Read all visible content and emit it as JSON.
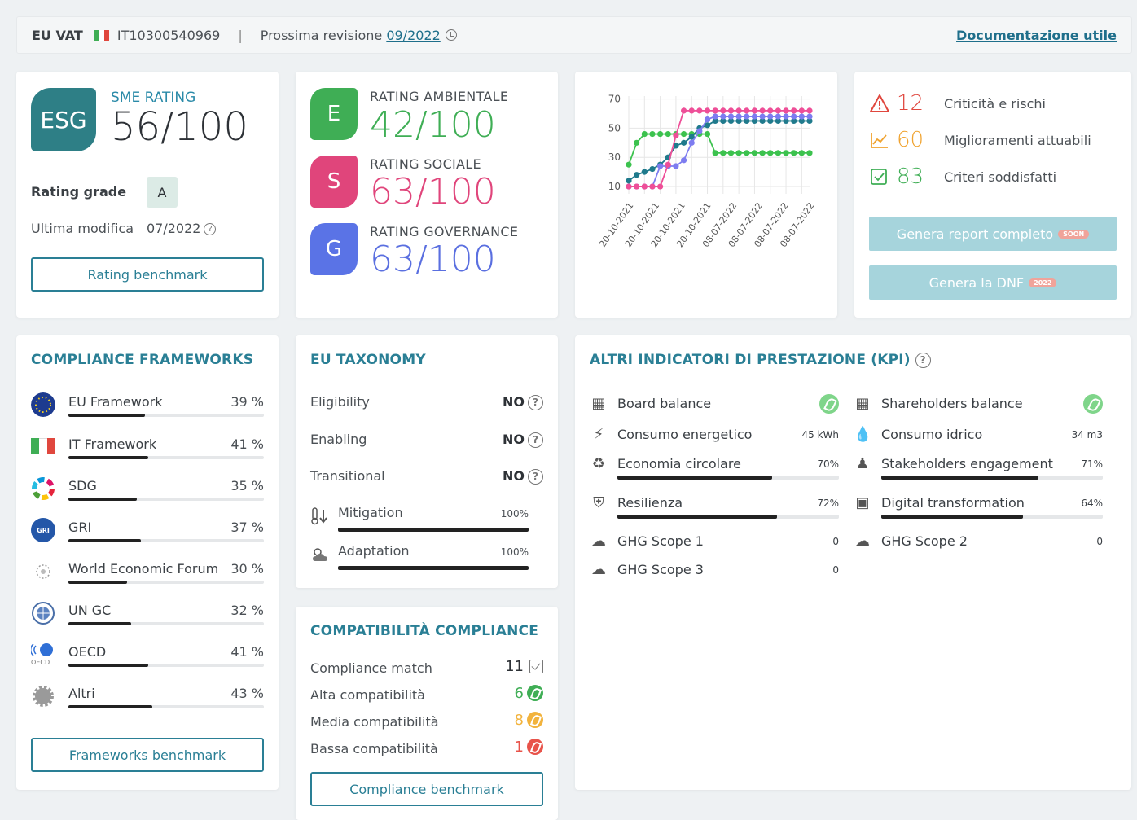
{
  "topbar": {
    "vat_label": "EU VAT",
    "vat_number": "IT10300540969",
    "separator": "|",
    "review_label": "Prossima revisione",
    "review_date": "09/2022",
    "doc_link": "Documentazione utile"
  },
  "sme": {
    "badge": "ESG",
    "label": "SME RATING",
    "value": "56/100",
    "grade_label": "Rating grade",
    "grade": "A",
    "modified_label": "Ultima modifica",
    "modified_value": "07/2022",
    "benchmark_button": "Rating benchmark"
  },
  "ratings": [
    {
      "badge": "E",
      "label": "RATING AMBIENTALE",
      "value": "42/100",
      "color": "#3fae55",
      "badge_color": "#3fae55"
    },
    {
      "badge": "S",
      "label": "RATING SOCIALE",
      "value": "63/100",
      "color": "#e0457b",
      "badge_color": "#e0457b"
    },
    {
      "badge": "G",
      "label": "RATING GOVERNANCE",
      "value": "63/100",
      "color": "#5a6fe0",
      "badge_color": "#5a73e6"
    }
  ],
  "chart_data": {
    "type": "line",
    "categories": [
      "20-10-2021",
      "20-10-2021",
      "20-10-2021",
      "20-10-2021",
      "08-07-2022",
      "08-07-2022",
      "08-07-2022",
      "08-07-2022"
    ],
    "xlabel": "",
    "ylabel": "",
    "ylim": [
      5,
      72
    ],
    "yticks": [
      10,
      30,
      50,
      70
    ],
    "grid": true,
    "legend": "none",
    "series": [
      {
        "color": "#3cc24e",
        "values": [
          25,
          40,
          46,
          46,
          46,
          46,
          46,
          46,
          46,
          46,
          46,
          33,
          33,
          33,
          33,
          33,
          33,
          33,
          33,
          33,
          33,
          33,
          33,
          33
        ]
      },
      {
        "color": "#1f7a8c",
        "values": [
          14,
          18,
          20,
          22,
          25,
          30,
          38,
          40,
          44,
          50,
          52,
          55,
          55,
          55,
          55,
          55,
          55,
          55,
          55,
          55,
          55,
          55,
          55,
          55
        ]
      },
      {
        "color": "#7d7cf0",
        "values": [
          10,
          10,
          10,
          10,
          24,
          24,
          24,
          28,
          40,
          48,
          56,
          58,
          58,
          58,
          58,
          58,
          58,
          58,
          58,
          58,
          58,
          58,
          58,
          58
        ]
      },
      {
        "color": "#ee4f98",
        "values": [
          10,
          10,
          10,
          10,
          10,
          25,
          45,
          62,
          62,
          62,
          62,
          62,
          62,
          62,
          62,
          62,
          62,
          62,
          62,
          62,
          62,
          62,
          62,
          62
        ]
      }
    ]
  },
  "stats": [
    {
      "value": "12",
      "label": "Criticità e rischi",
      "color": "#e0473e",
      "icon": "warning-icon"
    },
    {
      "value": "60",
      "label": "Miglioramenti attuabili",
      "color": "#f0a330",
      "icon": "trend-chart-icon"
    },
    {
      "value": "83",
      "label": "Criteri soddisfatti",
      "color": "#3fae55",
      "icon": "checkbox-icon"
    }
  ],
  "actions": {
    "report_button": "Genera report completo",
    "report_badge": "SOON",
    "dnf_button": "Genera la DNF",
    "dnf_badge": "2022"
  },
  "frameworks": {
    "title": "COMPLIANCE FRAMEWORKS",
    "items": [
      {
        "name": "EU Framework",
        "pct": "39 %",
        "value": 39,
        "icon": "eu-flag-icon"
      },
      {
        "name": "IT Framework",
        "pct": "41 %",
        "value": 41,
        "icon": "italy-flag-icon"
      },
      {
        "name": "SDG",
        "pct": "35 %",
        "value": 35,
        "icon": "sdg-wheel-icon"
      },
      {
        "name": "GRI",
        "pct": "37 %",
        "value": 37,
        "icon": "gri-logo-icon",
        "icon_text": "GRI"
      },
      {
        "name": "World Economic Forum",
        "pct": "30 %",
        "value": 30,
        "icon": "wef-logo-icon"
      },
      {
        "name": "UN GC",
        "pct": "32 %",
        "value": 32,
        "icon": "un-globe-icon"
      },
      {
        "name": "OECD",
        "pct": "41 %",
        "value": 41,
        "icon": "oecd-logo-icon",
        "icon_text": "OECD"
      },
      {
        "name": "Altri",
        "pct": "43 %",
        "value": 43,
        "icon": "gear-icon"
      }
    ],
    "benchmark_button": "Frameworks benchmark"
  },
  "taxonomy": {
    "title": "EU TAXONOMY",
    "rows": [
      {
        "label": "Eligibility",
        "value": "NO"
      },
      {
        "label": "Enabling",
        "value": "NO"
      },
      {
        "label": "Transitional",
        "value": "NO"
      }
    ],
    "bars": [
      {
        "label": "Mitigation",
        "pct": "100%",
        "icon": "thermometer-icon"
      },
      {
        "label": "Adaptation",
        "pct": "100%",
        "icon": "weather-icon"
      }
    ]
  },
  "compat": {
    "title": "COMPATIBILITÀ COMPLIANCE",
    "rows": [
      {
        "label": "Compliance match",
        "value": "11",
        "color": "#2d3136"
      },
      {
        "label": "Alta compatibilità",
        "value": "6",
        "color": "#3fae55"
      },
      {
        "label": "Media compatibilità",
        "value": "8",
        "color": "#f2b33d"
      },
      {
        "label": "Bassa compatibilità",
        "value": "1",
        "color": "#e8534a"
      }
    ],
    "benchmark_button": "Compliance benchmark"
  },
  "kpi": {
    "title": "ALTRI INDICATORI DI PRESTAZIONE (KPI)",
    "left": [
      {
        "name": "Board balance",
        "value": "",
        "icon": "org-chart-icon",
        "leaf": true
      },
      {
        "name": "Consumo energetico",
        "value": "45 kWh",
        "icon": "plug-icon"
      },
      {
        "name": "Economia circolare",
        "value": "70%",
        "bar": 70,
        "icon": "recycle-icon"
      },
      {
        "name": "Resilienza",
        "value": "72%",
        "bar": 72,
        "icon": "shield-icon"
      },
      {
        "name": "GHG Scope 1",
        "value": "0",
        "icon": "cloud-icon"
      },
      {
        "name": "GHG Scope 3",
        "value": "0",
        "icon": "cloud-icon"
      }
    ],
    "right": [
      {
        "name": "Shareholders balance",
        "value": "",
        "icon": "org-chart-icon",
        "leaf": true
      },
      {
        "name": "Consumo idrico",
        "value": "34 m3",
        "icon": "water-drop-icon"
      },
      {
        "name": "Stakeholders engagement",
        "value": "71%",
        "bar": 71,
        "icon": "people-icon"
      },
      {
        "name": "Digital transformation",
        "value": "64%",
        "bar": 64,
        "icon": "robot-icon"
      },
      {
        "name": "GHG Scope 2",
        "value": "0",
        "icon": "cloud-icon"
      }
    ]
  }
}
